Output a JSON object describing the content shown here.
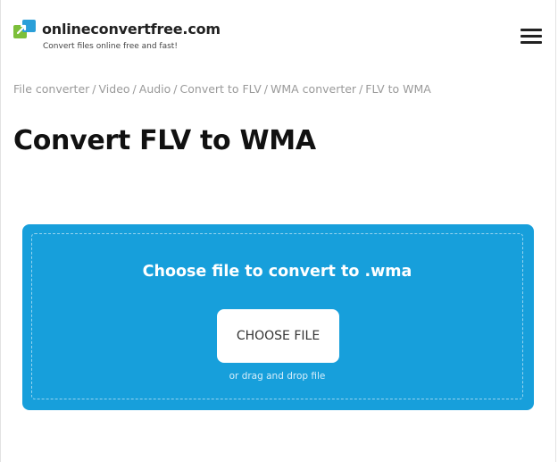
{
  "site": {
    "name": "onlineconvertfree.com",
    "tagline": "Convert files online free and fast!",
    "logo_icon": "convert-arrows-icon",
    "menu_icon": "hamburger-menu-icon"
  },
  "breadcrumb": {
    "items": [
      "File converter",
      "Video",
      "Audio",
      "Convert to FLV",
      "WMA converter",
      "FLV to WMA"
    ],
    "separator": "/"
  },
  "page": {
    "title": "Convert FLV to WMA"
  },
  "upload": {
    "heading": "Choose file to convert to .wma",
    "button_label": "CHOOSE FILE",
    "hint": "or drag and drop file"
  },
  "colors": {
    "accent": "#179fdb",
    "logo_green": "#7cbf3a",
    "logo_blue": "#2a9fd8",
    "text_dark": "#111111",
    "breadcrumb": "#9a9a9a"
  }
}
